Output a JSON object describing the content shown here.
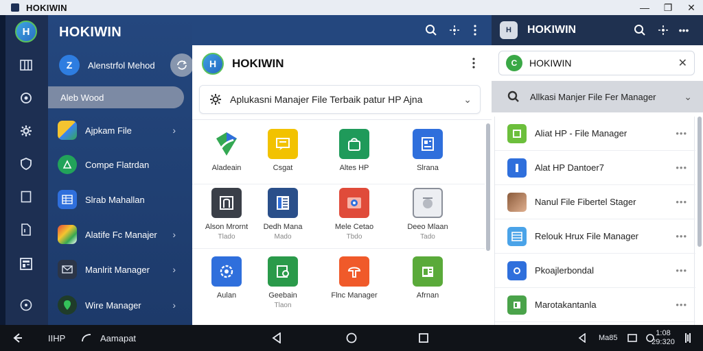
{
  "window": {
    "title": "HOKIWIN",
    "controls": [
      "—",
      "❐",
      "✕"
    ]
  },
  "rail": {
    "logo_text": "H",
    "icons": [
      "grid-icon",
      "camera-icon",
      "gear-icon",
      "shield-icon",
      "square-icon",
      "document-icon",
      "news-icon",
      "compass-icon"
    ]
  },
  "sidebar": {
    "title": "HOKIWIN",
    "account": {
      "name": "Alenstrfol Mehod",
      "avatar_letter": "Z"
    },
    "selected": "Aleb Wood",
    "items": [
      {
        "label": "Ajpkam File",
        "color": "#3b82f6",
        "chevron": true
      },
      {
        "label": "Compe Flatrdan",
        "color": "#22a35a",
        "chevron": false
      },
      {
        "label": "Slrab Mahallan",
        "color": "#2f6fdc",
        "chevron": false
      },
      {
        "label": "Alatife Fc Manajer",
        "color": "#e24b3a",
        "chevron": true
      },
      {
        "label": "Manlrit Manager",
        "color": "#2b3548",
        "chevron": true
      },
      {
        "label": "Wire Manager",
        "color": "#1f3c2a",
        "chevron": true
      }
    ]
  },
  "main": {
    "title": "HOKIWIN",
    "logo_text": "H",
    "dropdown": "Aplukasni Manajer File Terbaik patur HP Ajna",
    "grid": [
      {
        "label": "Aladeain",
        "sub": "",
        "color": "#ffffff",
        "icon": "chrome"
      },
      {
        "label": "Csgat",
        "sub": "",
        "color": "#f2c200",
        "icon": "note"
      },
      {
        "label": "Altes HP",
        "sub": "",
        "color": "#1f9a5a",
        "icon": "bag"
      },
      {
        "label": "Slrana",
        "sub": "",
        "color": "#2f6fdc",
        "icon": "doc"
      },
      {
        "label": "Alson Mrornt",
        "sub": "Tlado",
        "color": "#3a3f48",
        "icon": "frame"
      },
      {
        "label": "Dedh Mana",
        "sub": "Mado",
        "color": "#2a4f8a",
        "icon": "list"
      },
      {
        "label": "Mele Cetao",
        "sub": "Tbdo",
        "color": "#e04b3a",
        "icon": "photo"
      },
      {
        "label": "Deeo Mlaan",
        "sub": "Tado",
        "color": "#8a8f99",
        "icon": "disk"
      },
      {
        "label": "Aulan",
        "sub": "",
        "color": "#2f6fdc",
        "icon": "ring"
      },
      {
        "label": "Geebain",
        "sub": "Tlaon",
        "color": "#2a9a4a",
        "icon": "folder"
      },
      {
        "label": "Flnc Manager",
        "sub": "",
        "color": "#f05a2a",
        "icon": "anchor"
      },
      {
        "label": "Afrnan",
        "sub": "",
        "color": "#5aaa3a",
        "icon": "note2"
      }
    ]
  },
  "right": {
    "title": "HOKIWIN",
    "search_value": "HOKIWIN",
    "dropdown": "Allkasi Manjer File Fer Manager",
    "list": [
      {
        "label": "Aliat HP - File Manager",
        "color": "#6cbf3c"
      },
      {
        "label": "Alat HP Dantoer7",
        "color": "#2f6fdc"
      },
      {
        "label": "Nanul File Fibertel Stager",
        "color": "#8a5a3a"
      },
      {
        "label": "Relouk Hrux File Manager",
        "color": "#4aa3e8"
      },
      {
        "label": "Pkoajlerbondal",
        "color": "#2f6fdc"
      },
      {
        "label": "Marotakantanla",
        "color": "#4aa34a"
      }
    ],
    "more": "•••"
  },
  "navbar": {
    "left_label": "IIHP",
    "app_label": "Aamapat",
    "status_text": "Ma85",
    "time": "1:08",
    "date": "29:320"
  }
}
